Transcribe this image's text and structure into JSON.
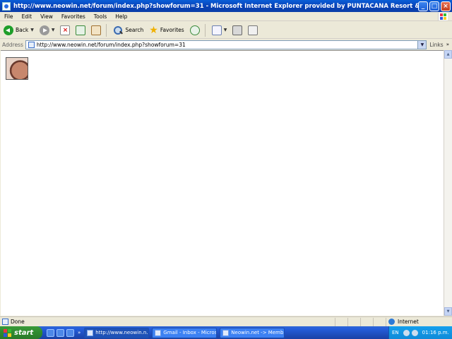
{
  "window": {
    "title": "http://www.neowin.net/forum/index.php?showforum=31 - Microsoft Internet Explorer provided by PUNTACANA Resort & Club",
    "min": "_",
    "max": "□",
    "close": "×"
  },
  "menu": [
    "File",
    "Edit",
    "View",
    "Favorites",
    "Tools",
    "Help"
  ],
  "toolbar": {
    "back": "Back",
    "search": "Search",
    "favorites": "Favorites"
  },
  "address": {
    "label": "Address",
    "url": "http://www.neowin.net/forum/index.php?showforum=31",
    "links": "Links",
    "links_chevron": "»"
  },
  "status": {
    "text": "Done",
    "zone": "Internet"
  },
  "taskbar": {
    "start": "start",
    "quicklaunch_more": "»",
    "tasks": [
      "http://www.neowin.n...",
      "Gmail - Inbox - Micros...",
      "Neowin.net -> Memb..."
    ],
    "lang": "EN",
    "clock": "01:16 p.m."
  },
  "colors": {
    "titlebar": "#0a5fd8",
    "taskbar": "#245edb",
    "start": "#2f8a2f"
  }
}
